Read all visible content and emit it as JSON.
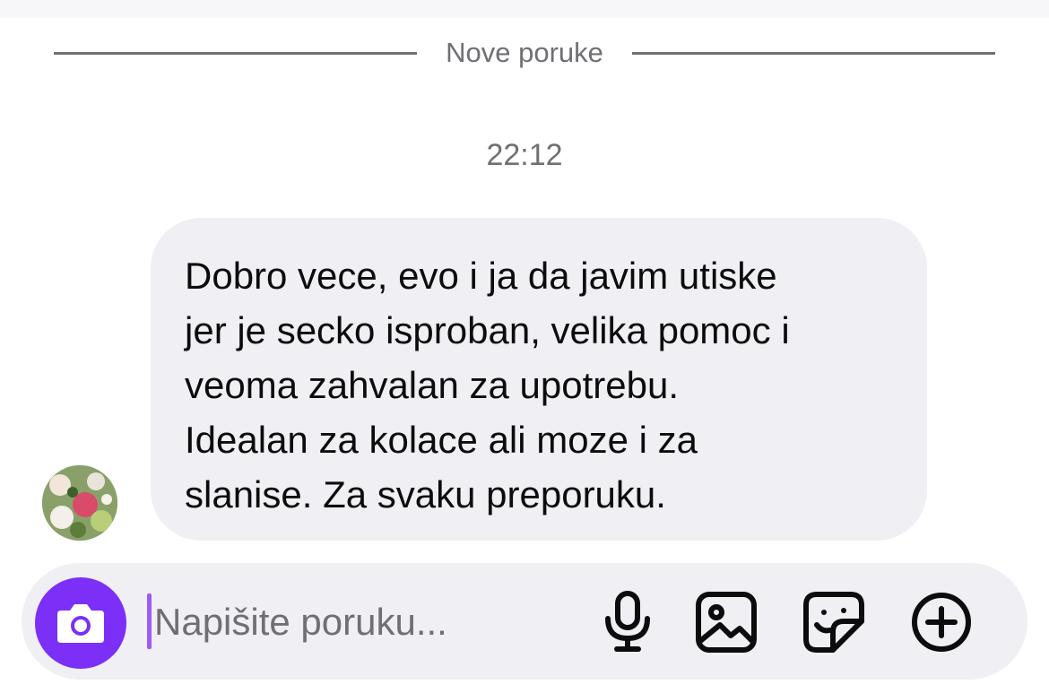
{
  "divider": {
    "label": "Nove poruke"
  },
  "conversation": {
    "timestamp": "22:12",
    "message": {
      "lines": [
        "Dobro vece, evo i ja da javim utiske",
        "jer je secko isproban, velika pomoc i",
        "veoma zahvalan za upotrebu.",
        "Idealan za kolace ali moze i za",
        "slanise. Za svaku preporuku."
      ]
    }
  },
  "composer": {
    "placeholder": "Napišite poruku...",
    "icons": {
      "camera": "camera-icon",
      "microphone": "microphone-icon",
      "gallery": "image-gallery-icon",
      "sticker": "sticker-icon",
      "add": "add-circle-icon"
    }
  },
  "colors": {
    "accent": "#7b2ff7",
    "bubble": "#efeff4",
    "muted_text": "#6f6f74"
  }
}
